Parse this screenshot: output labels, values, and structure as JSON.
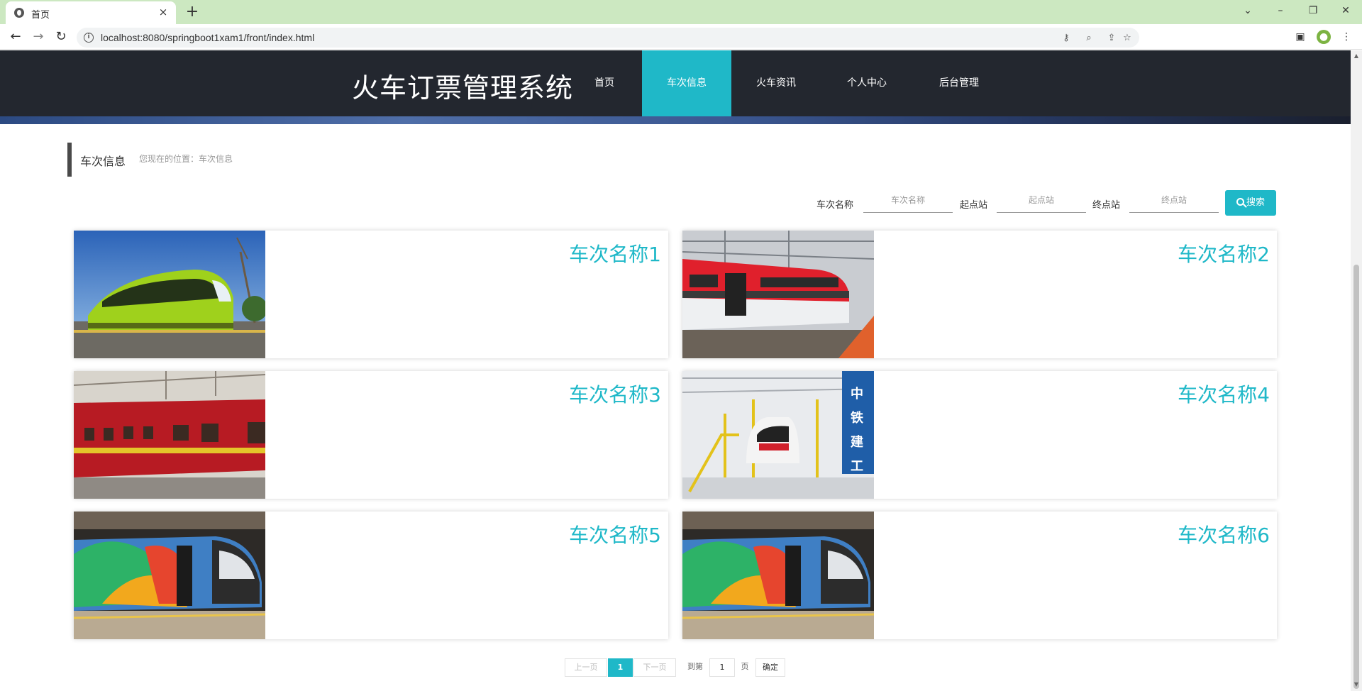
{
  "browser": {
    "tab_title": "首页",
    "tab_close": "×",
    "new_tab": "+",
    "url": "localhost:8080/springboot1xam1/front/index.html",
    "win_controls": [
      "⌄",
      "–",
      "❐",
      "✕"
    ]
  },
  "header": {
    "site_title": "火车订票管理系统",
    "nav": [
      {
        "label": "首页",
        "active": false
      },
      {
        "label": "车次信息",
        "active": true
      },
      {
        "label": "火车资讯",
        "active": false
      },
      {
        "label": "个人中心",
        "active": false
      },
      {
        "label": "后台管理",
        "active": false
      }
    ]
  },
  "breadcrumb": {
    "title": "车次信息",
    "path": "您现在的位置：车次信息"
  },
  "search": {
    "name_label": "车次名称",
    "name_placeholder": "车次名称",
    "start_label": "起点站",
    "start_placeholder": "起点站",
    "end_label": "终点站",
    "end_placeholder": "终点站",
    "button_label": "搜索"
  },
  "trains": [
    {
      "name": "车次名称1",
      "image": "green-tram-icon"
    },
    {
      "name": "车次名称2",
      "image": "red-white-train-icon"
    },
    {
      "name": "车次名称3",
      "image": "red-passenger-car-icon"
    },
    {
      "name": "车次名称4",
      "image": "metro-depot-icon"
    },
    {
      "name": "车次名称5",
      "image": "colorful-metro-icon"
    },
    {
      "name": "车次名称6",
      "image": "colorful-metro-icon"
    }
  ],
  "pagination": {
    "prev": "上一页",
    "current": "1",
    "next": "下一页",
    "goto_label": "到第",
    "page_input": "1",
    "page_unit": "页",
    "confirm": "确定"
  },
  "colors": {
    "accent": "#1fb8c8",
    "header_bg": "#23272f"
  }
}
